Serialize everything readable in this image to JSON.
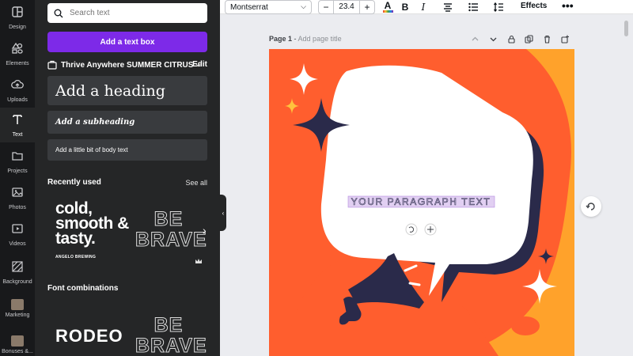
{
  "rail": [
    {
      "label": "Design",
      "icon": "design-icon"
    },
    {
      "label": "Elements",
      "icon": "elements-icon"
    },
    {
      "label": "Uploads",
      "icon": "upload-icon"
    },
    {
      "label": "Text",
      "icon": "text-icon",
      "active": true
    },
    {
      "label": "Projects",
      "icon": "folder-icon"
    },
    {
      "label": "Photos",
      "icon": "photo-icon"
    },
    {
      "label": "Videos",
      "icon": "video-icon"
    },
    {
      "label": "Background",
      "icon": "background-icon"
    },
    {
      "label": "Marketing",
      "icon": "marketing-thumb"
    },
    {
      "label": "Bonuses &...",
      "icon": "bonuses-thumb"
    }
  ],
  "panel": {
    "search_placeholder": "Search text",
    "add_textbox": "Add a text box",
    "brand_kit": "Thrive Anywhere SUMMER CITRUS",
    "brand_kit_edit": "Edit",
    "heading": "Add a heading",
    "subheading": "Add a subheading",
    "body": "Add a little bit of body text",
    "recently_used": "Recently used",
    "see_all": "See all",
    "recent": {
      "cold_text": "cold, smooth & tasty.",
      "cold_sub": "ANGELO BREWING",
      "be_brave_1": "BE",
      "be_brave_2": "BRAVE"
    },
    "font_combinations": "Font combinations",
    "combos": {
      "rodeo": "RODEO",
      "be_brave_1": "BE",
      "be_brave_2": "BRAVE"
    }
  },
  "toolbar": {
    "font": "Montserrat",
    "minus": "−",
    "font_size": "23.4",
    "plus": "+",
    "text_color_glyph": "A",
    "bold": "B",
    "italic": "I",
    "effects": "Effects",
    "more": "•••"
  },
  "page": {
    "label": "Page 1",
    "separator": " - ",
    "title_placeholder": "Add page title"
  },
  "canvas": {
    "paragraph": "YOUR PARAGRAPH TEXT",
    "colors": {
      "background": "#ffa22b",
      "blob": "#ff5e2e",
      "navy": "#2a2a4a",
      "bubble": "#ffffff",
      "selection": "#c9a8e8"
    }
  }
}
